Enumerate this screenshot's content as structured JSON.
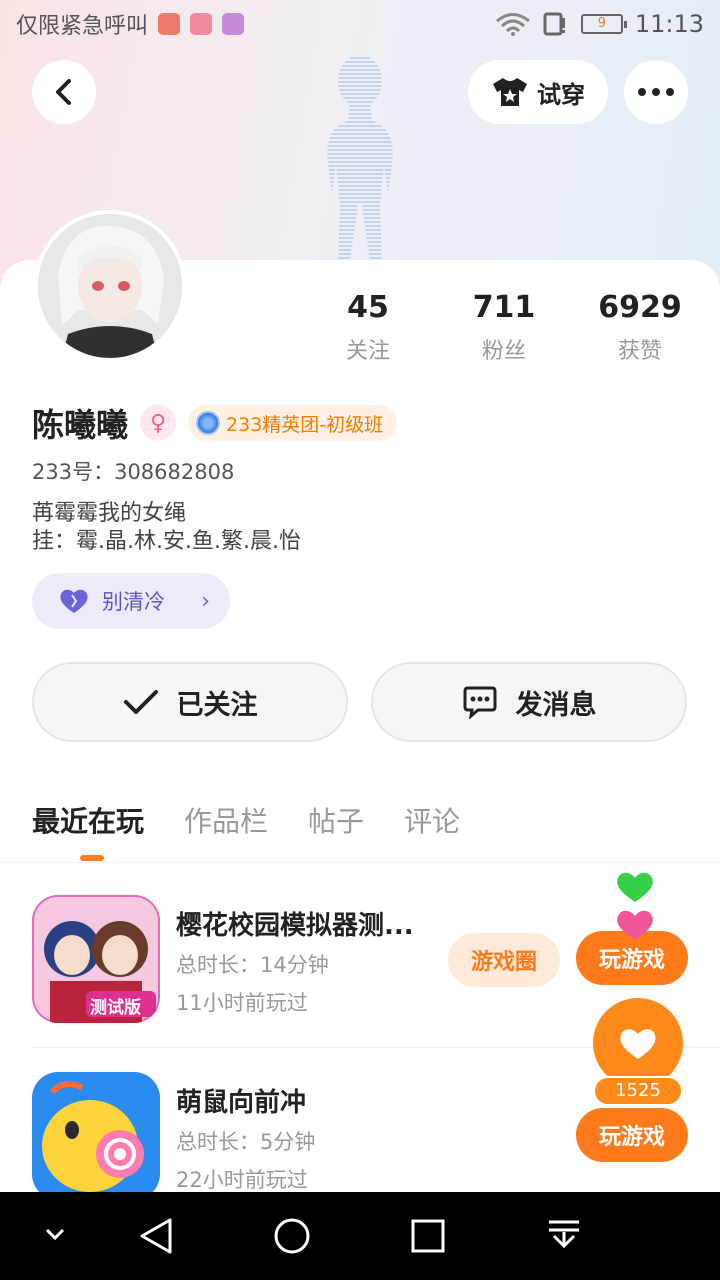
{
  "status_bar": {
    "carrier": "仅限紧急呼叫",
    "battery_level": "9",
    "time": "11:13"
  },
  "header": {
    "tryon_label": "试穿"
  },
  "profile": {
    "stats": [
      {
        "value": "45",
        "label": "关注"
      },
      {
        "value": "711",
        "label": "粉丝"
      },
      {
        "value": "6929",
        "label": "获赞"
      }
    ],
    "name": "陈曦曦",
    "level_badge": "233精英团-初级班",
    "uid": "233号：308682808",
    "bio_line1": "苒霉霉我的女绳",
    "bio_line2": "挂：霉.晶.林.安.鱼.繁.晨.怡",
    "tag_label": "别清冷"
  },
  "actions": {
    "follow_label": "已关注",
    "message_label": "发消息"
  },
  "tabs": [
    "最近在玩",
    "作品栏",
    "帖子",
    "评论"
  ],
  "games": [
    {
      "title": "樱花校园模拟器测...",
      "duration": "总时长：14分钟",
      "last_played": "11小时前玩过",
      "circle_label": "游戏圈",
      "play_label": "玩游戏",
      "icon_badge": "测试版"
    },
    {
      "title": "萌鼠向前冲",
      "duration": "总时长：5分钟",
      "last_played": "22小时前玩过",
      "play_label": "玩游戏"
    }
  ],
  "like_float": {
    "count": "1525"
  },
  "colors": {
    "accent": "#ff7a1a",
    "tag_purple": "#5b57c9"
  }
}
